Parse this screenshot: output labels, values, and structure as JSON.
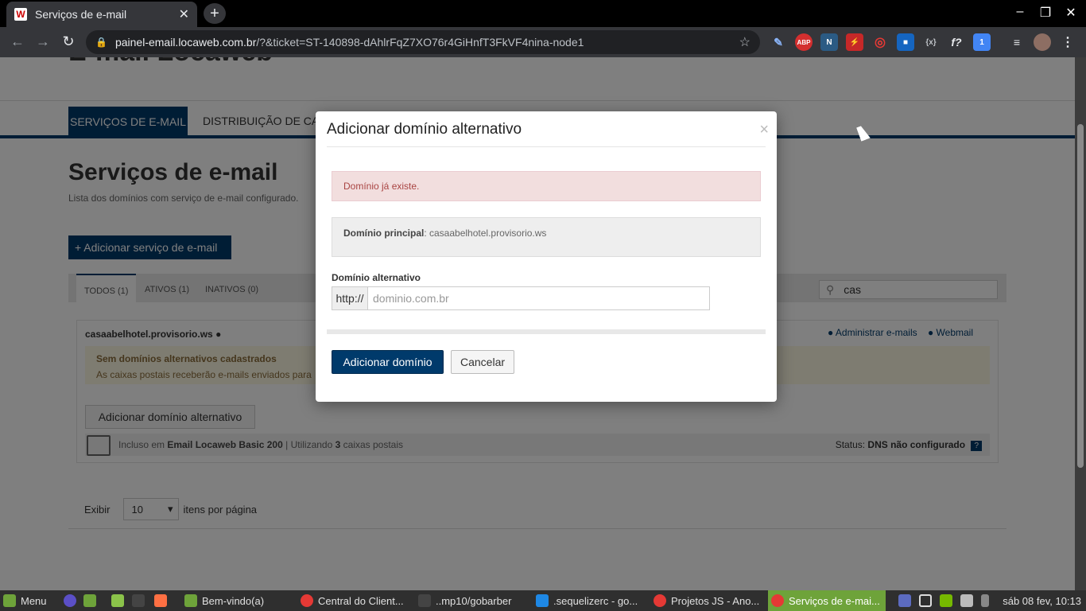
{
  "browser": {
    "tab_title": "Serviços de e-mail",
    "tab_favicon": "W",
    "new_tab_label": "+",
    "url_host": "painel-email.locaweb.com.br",
    "url_path": "/?&ticket=ST-140898-dAhlrFqZ7XO76r4GiHnfT3FkVF4nina-node1",
    "extensions": [
      "pen-icon",
      "adblock-icon",
      "n-extension-icon",
      "flash-icon",
      "target-icon",
      "square-icon",
      "json-icon",
      "formula-icon",
      "calendar-icon",
      "playlist-icon",
      "profile-avatar"
    ],
    "ext_labels": {
      "abp": "ABP",
      "json": "{x}",
      "formula": "f?"
    }
  },
  "page": {
    "site_title": "E-mail Locaweb",
    "nav_active": "SERVIÇOS DE E-MAIL",
    "nav_item": "DISTRIBUIÇÃO DE CAIXAS",
    "title": "Serviços de e-mail",
    "subtitle": "Lista dos domínios com serviço de e-mail configurado.",
    "add_service": "+ Adicionar serviço de e-mail",
    "filter_tabs": [
      "TODOS (1)",
      "ATIVOS (1)",
      "INATIVOS (0)"
    ],
    "search_value": "cas",
    "domain": {
      "name": "casaabelhotel.provisorio.ws",
      "manage_emails": "Administrar e-mails",
      "webmail": "Webmail",
      "warn_title": "Sem domínios alternativos cadastrados",
      "warn_text": "As caixas postais receberão e-mails enviados para",
      "alt_button": "Adicionar domínio alternativo",
      "plan_prefix": "Incluso em",
      "plan_name": "Email Locaweb Basic 200",
      "plan_mid": "| Utilizando",
      "plan_count": "3",
      "plan_suffix": "caixas postais",
      "status_label": "Status:",
      "status_value": "DNS não configurado",
      "status_help": "?"
    },
    "per_page_label": "Exibir",
    "per_page_value": "10",
    "per_page_suffix": "itens por página"
  },
  "modal": {
    "title": "Adicionar domínio alternativo",
    "close": "×",
    "error": "Domínio já existe.",
    "main_domain_label": "Domínio principal",
    "main_domain_value": ": casaabelhotel.provisorio.ws",
    "alt_label": "Domínio alternativo",
    "prefix": "http://",
    "placeholder": "dominio.com.br",
    "submit": "Adicionar domínio",
    "cancel": "Cancelar"
  },
  "taskbar": {
    "menu": "Menu",
    "items": [
      "Bem-vindo(a)",
      "Central do Client...",
      "..mp10/gobarber",
      ".sequelizerc - go...",
      "Projetos JS - Ano...",
      "Serviços de e-mai..."
    ],
    "clock": "sáb 08 fev, 10:13"
  },
  "colors": {
    "brand": "#003a6b",
    "error_bg": "#f2dede",
    "error_text": "#a94442",
    "taskbar_active": "#6ea33a"
  }
}
